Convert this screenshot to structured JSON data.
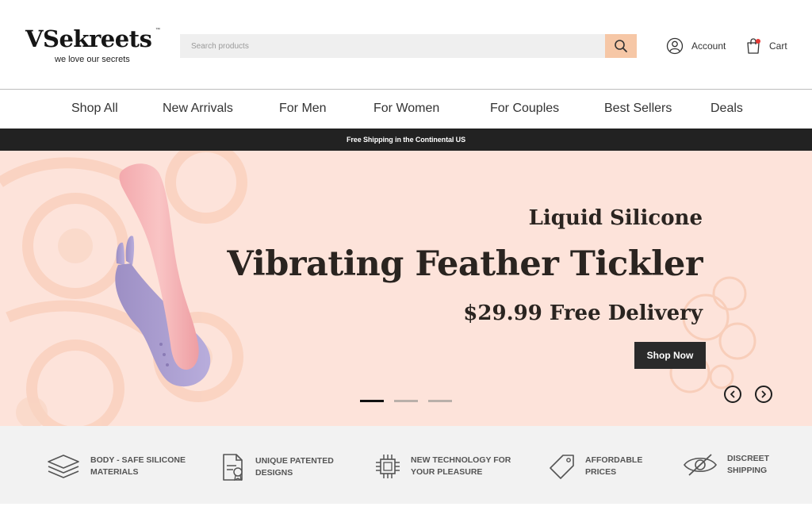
{
  "brand": {
    "name": "VSekreets",
    "tagline": "we love our secrets",
    "tm": "™"
  },
  "search": {
    "placeholder": "Search products",
    "icon": "search-icon"
  },
  "header": {
    "account_label": "Account",
    "cart_label": "Cart"
  },
  "nav": {
    "items": [
      {
        "label": "Shop All"
      },
      {
        "label": "New Arrivals"
      },
      {
        "label": "For Men"
      },
      {
        "label": "For Women"
      },
      {
        "label": "For Couples"
      },
      {
        "label": "Best Sellers"
      },
      {
        "label": "Deals"
      }
    ]
  },
  "announcement": "Free Shipping in the Continental US",
  "hero": {
    "subtitle": "Liquid Silicone",
    "title": "Vibrating Feather Tickler",
    "price_line": "$29.99 Free Delivery",
    "cta": "Shop Now",
    "slides_total": 3,
    "active_slide": 1
  },
  "features": [
    {
      "icon": "layers-icon",
      "text": "BODY - SAFE SILICONE\nMATERIALS"
    },
    {
      "icon": "document-icon",
      "text": "UNIQUE PATENTED\nDESIGNS"
    },
    {
      "icon": "chip-icon",
      "text": "NEW TECHNOLOGY FOR\nYOUR PLEASURE"
    },
    {
      "icon": "tag-icon",
      "text": "AFFORDABLE\nPRICES"
    },
    {
      "icon": "eye-slash-icon",
      "text": "DISCREET\nSHIPPING"
    }
  ],
  "colors": {
    "accent": "#f6c7a6",
    "hero_bg": "#fde3da",
    "dark": "#222222"
  }
}
